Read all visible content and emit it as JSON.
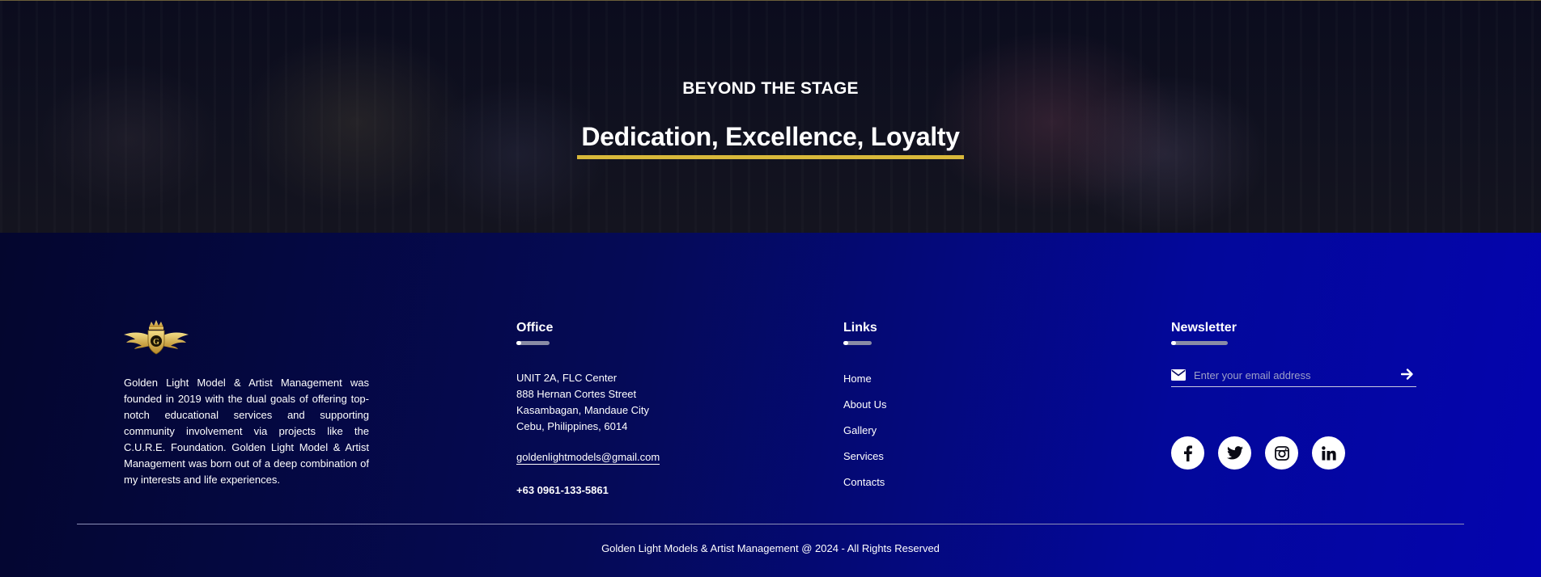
{
  "hero": {
    "kicker": "BEYOND THE STAGE",
    "title": "Dedication, Excellence, Loyalty",
    "underline_color": "#d8b83a"
  },
  "footer": {
    "logo": {
      "icon": "golden-crown-wings-logo",
      "monogram": "G"
    },
    "about": "Golden Light Model & Artist Management was founded in 2019 with the dual goals of offering top-notch educational services and supporting community involvement via projects like the C.U.R.E. Foundation. Golden Light Model & Artist Management was born out of a deep combination of my interests and life experiences.",
    "office": {
      "heading": "Office",
      "address_lines": [
        "UNIT 2A, FLC Center",
        "888 Hernan Cortes Street",
        "Kasambagan, Mandaue City",
        "Cebu, Philippines, 6014"
      ],
      "email": "goldenlightmodels@gmail.com",
      "phone": "+63 0961-133-5861"
    },
    "links": {
      "heading": "Links",
      "items": [
        "Home",
        "About Us",
        "Gallery",
        "Services",
        "Contacts"
      ]
    },
    "newsletter": {
      "heading": "Newsletter",
      "placeholder": "Enter your email address",
      "mail_icon": "envelope-icon",
      "submit_icon": "arrow-right-icon"
    },
    "socials": [
      "facebook-icon",
      "twitter-icon",
      "instagram-icon",
      "linkedin-icon"
    ],
    "copyright": "Golden Light Models & Artist Management @ 2024 - All Rights Reserved"
  }
}
